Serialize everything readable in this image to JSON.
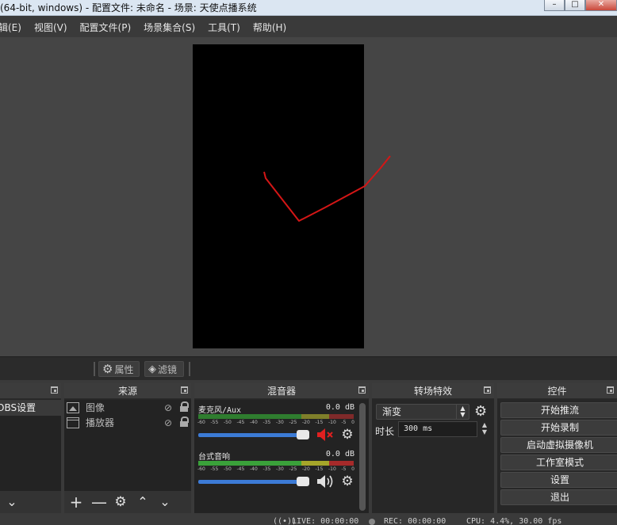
{
  "window": {
    "title": "(64-bit, windows) - 配置文件: 未命名 - 场景: 天使点播系统",
    "controls": [
      "minimize-icon",
      "maximize-icon",
      "close-icon"
    ]
  },
  "menu": {
    "items": [
      "辑(E)",
      "视图(V)",
      "配置文件(P)",
      "场景集合(S)",
      "工具(T)",
      "帮助(H)"
    ]
  },
  "context_toolbar": {
    "properties_label": "属性",
    "filters_label": "滤镜"
  },
  "scenes": {
    "items": [
      "OBS设置"
    ]
  },
  "sources": {
    "title": "来源",
    "items": [
      {
        "name": "图像",
        "icon": "image-icon"
      },
      {
        "name": "播放器",
        "icon": "media-source-icon"
      }
    ]
  },
  "mixer": {
    "title": "混音器",
    "scale": [
      "-60",
      "-55",
      "-50",
      "-45",
      "-40",
      "-35",
      "-30",
      "-25",
      "-20",
      "-15",
      "-10",
      "-5",
      "0"
    ],
    "channels": [
      {
        "name": "麦克风/Aux",
        "db": "0.0 dB",
        "muted": true,
        "volume": 1.0
      },
      {
        "name": "台式音响",
        "db": "0.0 dB",
        "muted": false,
        "volume": 1.0
      }
    ]
  },
  "transitions": {
    "title": "转场特效",
    "selected": "渐变",
    "duration_label": "时长",
    "duration_value": "300 ms"
  },
  "controls": {
    "title": "控件",
    "buttons": [
      "开始推流",
      "开始录制",
      "启动虚拟摄像机",
      "工作室模式",
      "设置",
      "退出"
    ]
  },
  "status": {
    "live": "LIVE: 00:00:00",
    "rec": "REC: 00:00:00",
    "cpu": "CPU: 4.4%, 30.00 fps"
  },
  "colors": {
    "annotation_stroke": "#d41616",
    "slider_blue": "#3c7bd6",
    "mute_red": "#e02020"
  }
}
